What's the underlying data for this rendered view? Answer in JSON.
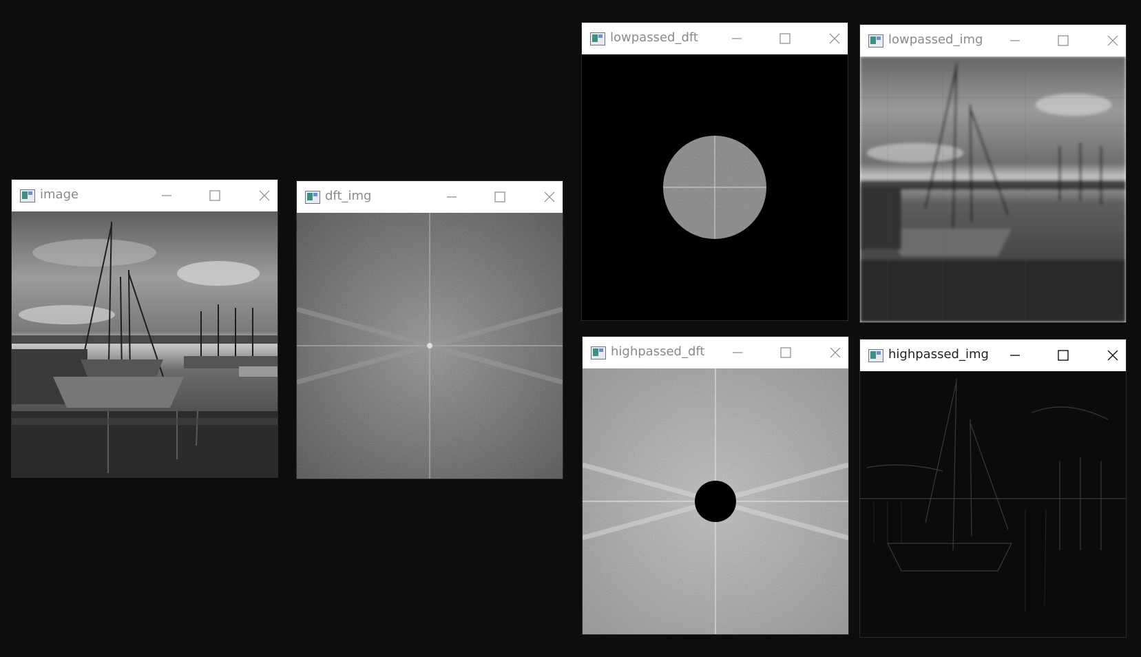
{
  "windows": {
    "image": {
      "title": "image",
      "minimize_icon": "minimize-icon",
      "maximize_icon": "maximize-icon",
      "close_icon": "close-icon"
    },
    "dft_img": {
      "title": "dft_img"
    },
    "lowpassed_dft": {
      "title": "lowpassed_dft"
    },
    "lowpassed_img": {
      "title": "lowpassed_img"
    },
    "highpassed_dft": {
      "title": "highpassed_dft"
    },
    "highpassed_img": {
      "title": "highpassed_img",
      "active": true
    }
  },
  "colors": {
    "desktop": "#0d0d0e",
    "titlebar": "#ffffff",
    "inactive_title": "#8a8a8a",
    "active_title": "#222222"
  }
}
